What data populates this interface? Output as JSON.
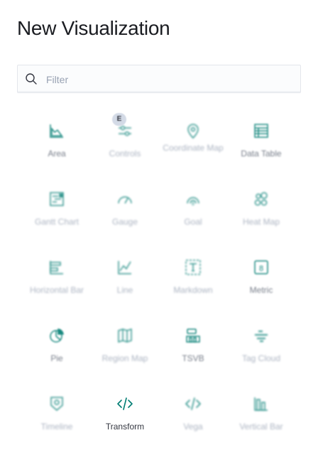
{
  "title": "New Visualization",
  "filter": {
    "placeholder": "Filter",
    "value": ""
  },
  "colors": {
    "accent": "#017d73",
    "text": "#343741",
    "muted": "#98a2b3"
  },
  "visualizations": [
    {
      "label": "Area",
      "icon": "area-chart-icon"
    },
    {
      "label": "Controls",
      "icon": "controls-icon",
      "badge": "E"
    },
    {
      "label": "Coordinate Map",
      "icon": "map-pin-icon"
    },
    {
      "label": "Data Table",
      "icon": "table-icon"
    },
    {
      "label": "Gantt Chart",
      "icon": "gantt-icon"
    },
    {
      "label": "Gauge",
      "icon": "gauge-icon"
    },
    {
      "label": "Goal",
      "icon": "goal-icon"
    },
    {
      "label": "Heat Map",
      "icon": "heatmap-icon"
    },
    {
      "label": "Horizontal Bar",
      "icon": "horizontal-bar-icon"
    },
    {
      "label": "Line",
      "icon": "line-chart-icon"
    },
    {
      "label": "Markdown",
      "icon": "markdown-icon"
    },
    {
      "label": "Metric",
      "icon": "metric-icon"
    },
    {
      "label": "Pie",
      "icon": "pie-icon"
    },
    {
      "label": "Region Map",
      "icon": "region-map-icon"
    },
    {
      "label": "TSVB",
      "icon": "tsvb-icon"
    },
    {
      "label": "Tag Cloud",
      "icon": "tag-cloud-icon"
    },
    {
      "label": "Timeline",
      "icon": "timeline-icon"
    },
    {
      "label": "Transform",
      "icon": "code-icon"
    },
    {
      "label": "Vega",
      "icon": "vega-icon"
    },
    {
      "label": "Vertical Bar",
      "icon": "vertical-bar-icon"
    }
  ]
}
